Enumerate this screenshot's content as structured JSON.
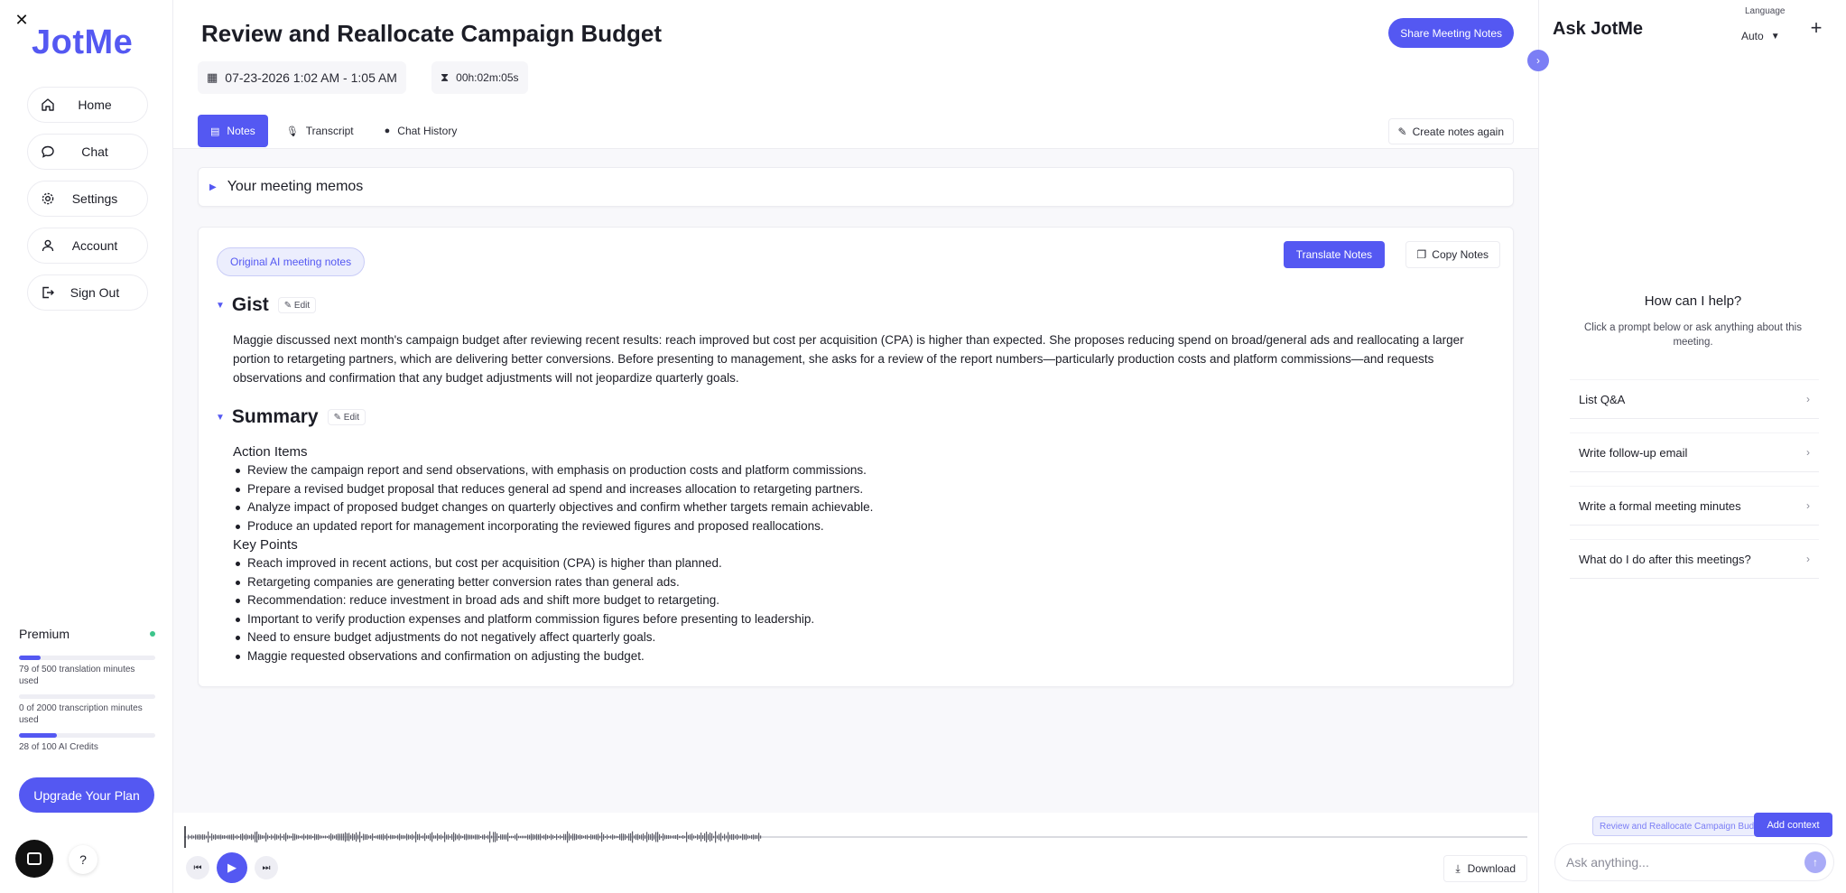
{
  "app": {
    "logo": "JotMe",
    "close_glyph": "✕"
  },
  "sidebar": {
    "items": [
      {
        "label": "Home",
        "icon": "home-icon"
      },
      {
        "label": "Chat",
        "icon": "chat-icon"
      },
      {
        "label": "Settings",
        "icon": "gear-icon"
      },
      {
        "label": "Account",
        "icon": "user-icon"
      },
      {
        "label": "Sign Out",
        "icon": "sign-out-icon"
      }
    ],
    "plan": {
      "name": "Premium",
      "status_color": "#3cc48b",
      "usage": [
        {
          "text": "79 of 500 translation minutes used",
          "fraction": 0.158
        },
        {
          "text": "0 of 2000 transcription minutes used",
          "fraction": 0.0
        },
        {
          "text": "28 of 100 AI Credits",
          "fraction": 0.28
        }
      ]
    },
    "upgrade_label": "Upgrade Your Plan",
    "help_label": "?"
  },
  "meeting": {
    "title": "Review and Reallocate Campaign Budget",
    "share_label": "Share Meeting Notes",
    "datetime": "07-23-2026 1:02 AM - 1:05 AM",
    "duration": "00h:02m:05s",
    "tabs": [
      {
        "label": "Notes",
        "icon": "notes-icon",
        "active": true
      },
      {
        "label": "Transcript",
        "icon": "microphone-icon",
        "active": false
      },
      {
        "label": "Chat History",
        "icon": "chat-icon",
        "active": false
      }
    ],
    "recreate_label": "Create notes again",
    "memos_label": "Your meeting memos"
  },
  "notes": {
    "ai_pill": "Original AI meeting notes",
    "translate_label": "Translate Notes",
    "copy_label": "Copy Notes",
    "edit_label": "Edit",
    "gist": {
      "title": "Gist",
      "text": "Maggie discussed next month's campaign budget after reviewing recent results: reach improved but cost per acquisition (CPA) is higher than expected. She proposes reducing spend on broad/general ads and reallocating a larger portion to retargeting partners, which are delivering better conversions. Before presenting to management, she asks for a review of the report numbers—particularly production costs and platform commissions—and requests observations and confirmation that any budget adjustments will not jeopardize quarterly goals."
    },
    "summary": {
      "title": "Summary",
      "action_items_title": "Action Items",
      "action_items": [
        "Review the campaign report and send observations, with emphasis on production costs and platform commissions.",
        "Prepare a revised budget proposal that reduces general ad spend and increases allocation to retargeting partners.",
        "Analyze impact of proposed budget changes on quarterly objectives and confirm whether targets remain achievable.",
        "Produce an updated report for management incorporating the reviewed figures and proposed reallocations."
      ],
      "key_points_title": "Key Points",
      "key_points": [
        "Reach improved in recent actions, but cost per acquisition (CPA) is higher than planned.",
        "Retargeting companies are generating better conversion rates than general ads.",
        "Recommendation: reduce investment in broad ads and shift more budget to retargeting.",
        "Important to verify production expenses and platform commission figures before presenting to leadership.",
        "Need to ensure budget adjustments do not negatively affect quarterly goals.",
        "Maggie requested observations and confirmation on adjusting the budget."
      ]
    }
  },
  "player": {
    "download_label": "Download",
    "waveform_played_fraction": 0.0
  },
  "ask": {
    "title": "Ask JotMe",
    "language_label": "Language",
    "language_value": "Auto",
    "help_title": "How can I help?",
    "help_sub": "Click a prompt below or ask anything about this meeting.",
    "prompts": [
      "List Q&A",
      "Write follow-up email",
      "Write a formal meeting minutes",
      "What do I do after this meetings?"
    ],
    "context_chip": "Review and Reallocate Campaign Budget",
    "add_context_label": "Add context",
    "input_placeholder": "Ask anything..."
  },
  "colors": {
    "accent": "#5458f2",
    "accent_light": "#eceefd"
  }
}
